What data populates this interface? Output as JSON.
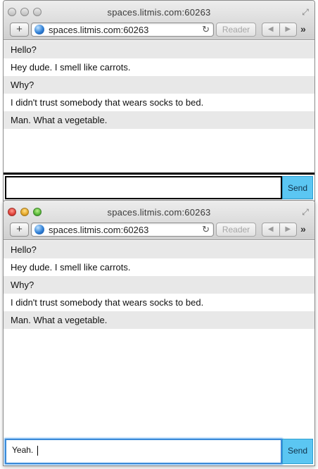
{
  "windows": [
    {
      "title": "spaces.litmis.com:60263",
      "toolbar": {
        "new_tab_label": "+",
        "url": "spaces.litmis.com:60263",
        "reader_label": "Reader",
        "back_label": "◀",
        "forward_label": "▶",
        "more_label": "»",
        "reload_label": "↻"
      },
      "messages": [
        "Hello?",
        "Hey dude. I smell like carrots.",
        "Why?",
        "I didn't trust somebody that wears socks to bed.",
        "Man. What a vegetable."
      ],
      "input": {
        "value": ""
      },
      "send_label": "Send"
    },
    {
      "title": "spaces.litmis.com:60263",
      "toolbar": {
        "new_tab_label": "+",
        "url": "spaces.litmis.com:60263",
        "reader_label": "Reader",
        "back_label": "◀",
        "forward_label": "▶",
        "more_label": "»",
        "reload_label": "↻"
      },
      "messages": [
        "Hello?",
        "Hey dude. I smell like carrots.",
        "Why?",
        "I didn't trust somebody that wears socks to bed.",
        "Man. What a vegetable."
      ],
      "input": {
        "value": "Yeah. "
      },
      "send_label": "Send"
    }
  ],
  "colors": {
    "send_button": "#5bc6f2",
    "message_alt_row": "#e8e8e8",
    "focus_ring": "#3b8ad8"
  }
}
